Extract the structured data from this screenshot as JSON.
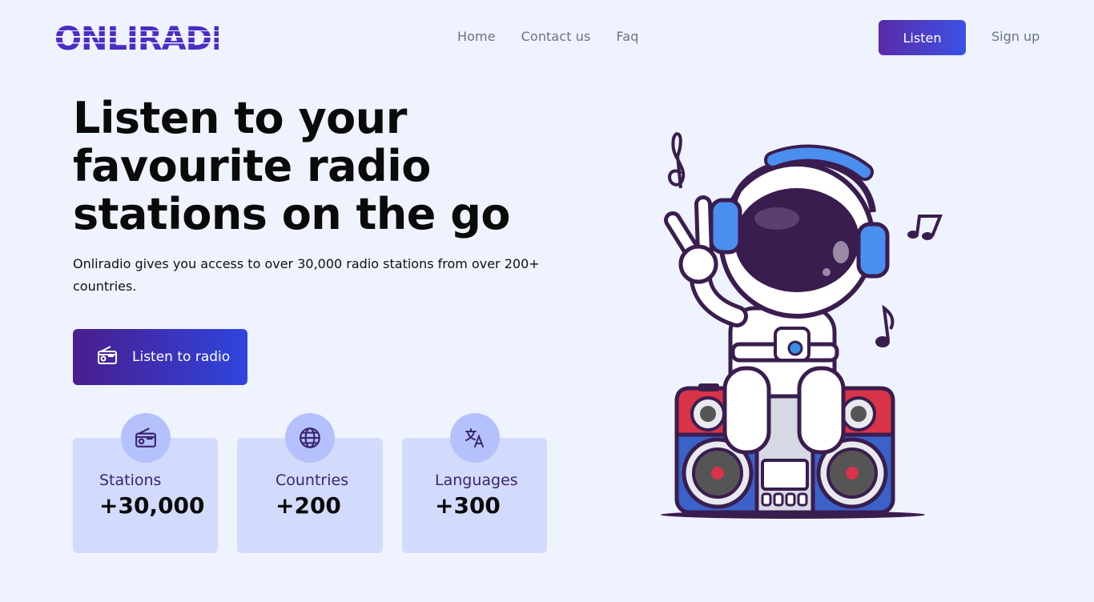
{
  "brand": {
    "logo_text": "ONLIRADIO"
  },
  "nav": {
    "items": [
      "Home",
      "Contact us",
      "Faq"
    ]
  },
  "header": {
    "listen_label": "Listen",
    "signup_label": "Sign up"
  },
  "hero": {
    "title_lines": [
      "Listen to your",
      "favourite radio",
      "stations on the go"
    ],
    "subtitle": "Onliradio gives you access to over 30,000 radio stations from over 200+ countries.",
    "cta_label": "Listen to radio"
  },
  "stats": [
    {
      "label": "Stations",
      "value": "+30,000",
      "icon": "radio-icon"
    },
    {
      "label": "Countries",
      "value": "+200",
      "icon": "globe-icon"
    },
    {
      "label": "Languages",
      "value": "+300",
      "icon": "translate-icon"
    }
  ],
  "colors": {
    "accent_start": "#5b2aa8",
    "accent_end": "#3b52e6",
    "background": "#eff3fe",
    "card": "#d3dbfd"
  }
}
